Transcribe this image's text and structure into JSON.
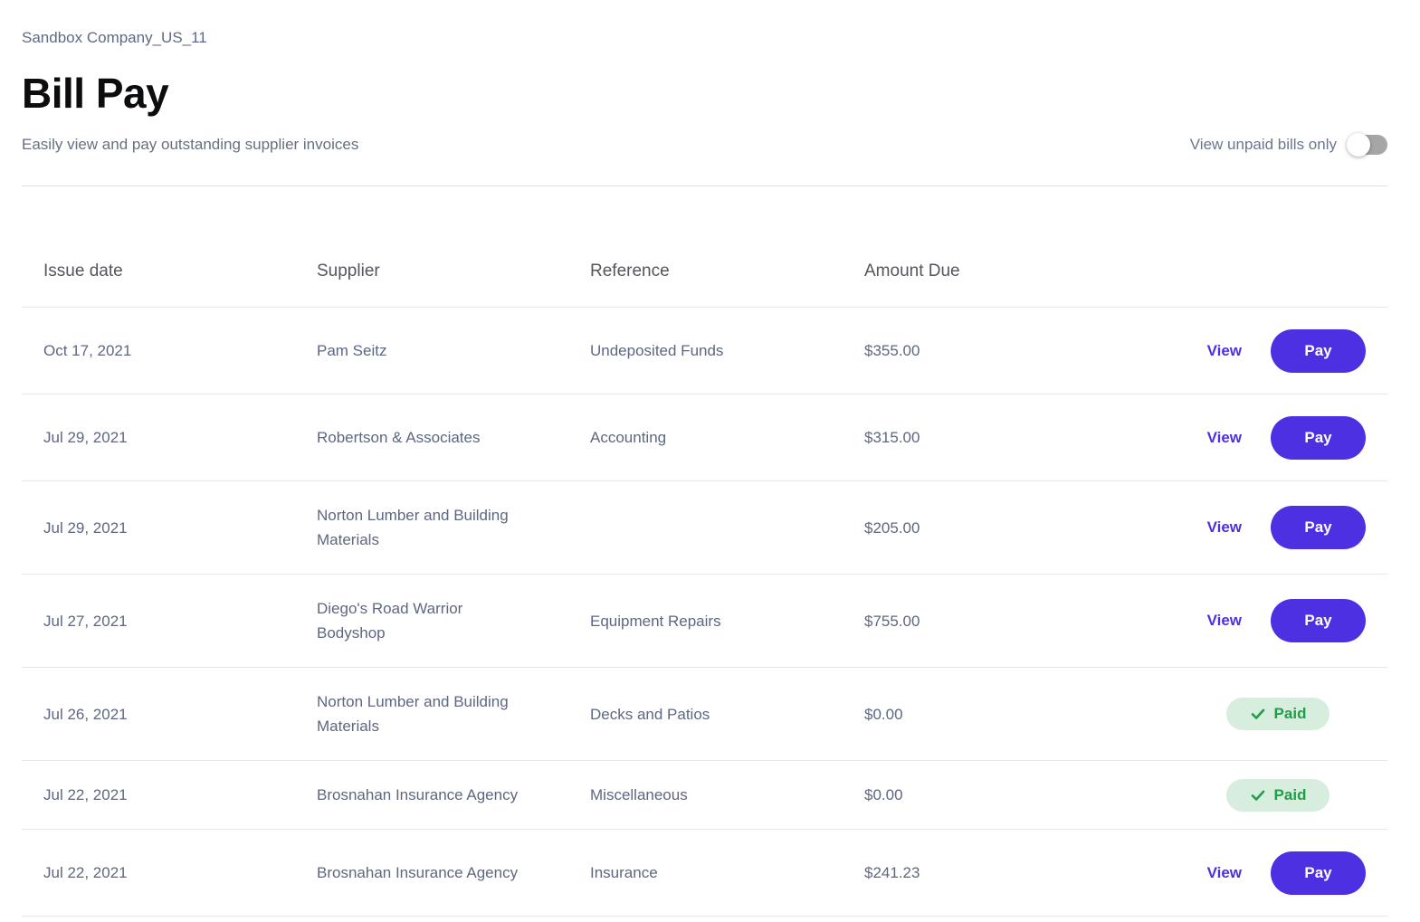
{
  "header": {
    "company": "Sandbox Company_US_11",
    "title": "Bill Pay",
    "subtitle": "Easily view and pay outstanding supplier invoices",
    "toggle_label": "View unpaid bills only",
    "toggle_state": "off"
  },
  "table": {
    "columns": [
      "Issue date",
      "Supplier",
      "Reference",
      "Amount Due"
    ],
    "actions": {
      "view_label": "View",
      "pay_label": "Pay",
      "paid_label": "Paid"
    },
    "rows": [
      {
        "issue_date": "Oct 17, 2021",
        "supplier": "Pam Seitz",
        "reference": "Undeposited Funds",
        "amount_due": "$355.00",
        "status": "unpaid"
      },
      {
        "issue_date": "Jul 29, 2021",
        "supplier": "Robertson & Associates",
        "reference": "Accounting",
        "amount_due": "$315.00",
        "status": "unpaid"
      },
      {
        "issue_date": "Jul 29, 2021",
        "supplier": "Norton Lumber and Building Materials",
        "reference": "",
        "amount_due": "$205.00",
        "status": "unpaid"
      },
      {
        "issue_date": "Jul 27, 2021",
        "supplier": "Diego's Road Warrior Bodyshop",
        "reference": "Equipment Repairs",
        "amount_due": "$755.00",
        "status": "unpaid"
      },
      {
        "issue_date": "Jul 26, 2021",
        "supplier": "Norton Lumber and Building Materials",
        "reference": "Decks and Patios",
        "amount_due": "$0.00",
        "status": "paid"
      },
      {
        "issue_date": "Jul 22, 2021",
        "supplier": "Brosnahan Insurance Agency",
        "reference": "Miscellaneous",
        "amount_due": "$0.00",
        "status": "paid"
      },
      {
        "issue_date": "Jul 22, 2021",
        "supplier": "Brosnahan Insurance Agency",
        "reference": "Insurance",
        "amount_due": "$241.23",
        "status": "unpaid"
      }
    ]
  },
  "colors": {
    "accent": "#4c30e2",
    "paid_text": "#1fa047",
    "paid_bg": "#d7edde",
    "toggle_track": "#a6a6a6"
  }
}
